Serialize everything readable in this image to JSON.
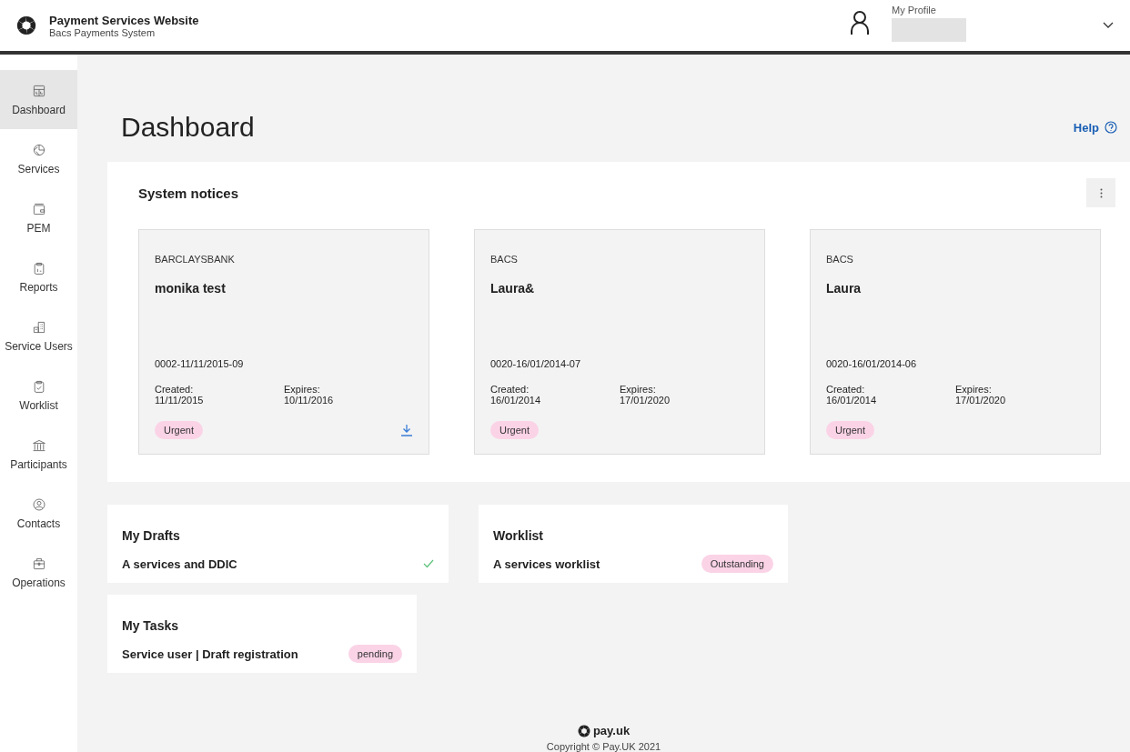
{
  "header": {
    "title": "Payment Services Website",
    "subtitle": "Bacs Payments System",
    "profile_label": "My Profile"
  },
  "sidebar": {
    "items": [
      {
        "label": "Dashboard",
        "selected": true
      },
      {
        "label": "Services",
        "selected": false
      },
      {
        "label": "PEM",
        "selected": false
      },
      {
        "label": "Reports",
        "selected": false
      },
      {
        "label": "Service Users",
        "selected": false
      },
      {
        "label": "Worklist",
        "selected": false
      },
      {
        "label": "Participants",
        "selected": false
      },
      {
        "label": "Contacts",
        "selected": false
      },
      {
        "label": "Operations",
        "selected": false
      }
    ]
  },
  "page": {
    "title": "Dashboard",
    "help": "Help"
  },
  "notices": {
    "title": "System notices",
    "cards": [
      {
        "source": "BARCLAYSBANK",
        "title": "monika test",
        "reference": "0002-11/11/2015-09",
        "created_label": "Created:",
        "created": "11/11/2015",
        "expires_label": "Expires:",
        "expires": "10/11/2016",
        "tag": "Urgent",
        "download": true
      },
      {
        "source": "BACS",
        "title": "Laura&",
        "reference": "0020-16/01/2014-07",
        "created_label": "Created:",
        "created": "16/01/2014",
        "expires_label": "Expires:",
        "expires": "17/01/2020",
        "tag": "Urgent",
        "download": false
      },
      {
        "source": "BACS",
        "title": "Laura",
        "reference": "0020-16/01/2014-06",
        "created_label": "Created:",
        "created": "16/01/2014",
        "expires_label": "Expires:",
        "expires": "17/01/2020",
        "tag": "Urgent",
        "download": false
      }
    ]
  },
  "widgets": [
    {
      "title": "My Drafts",
      "item": "A services and DDIC",
      "kind": "check"
    },
    {
      "title": "Worklist",
      "item": "A services worklist",
      "kind": "badge",
      "badge": "Outstanding"
    },
    {
      "title": "My Tasks",
      "item": "Service user | Draft registration",
      "kind": "badge",
      "badge": "pending"
    }
  ],
  "footer": {
    "brand": "pay.uk",
    "copyright": "Copyright © Pay.UK 2021"
  }
}
